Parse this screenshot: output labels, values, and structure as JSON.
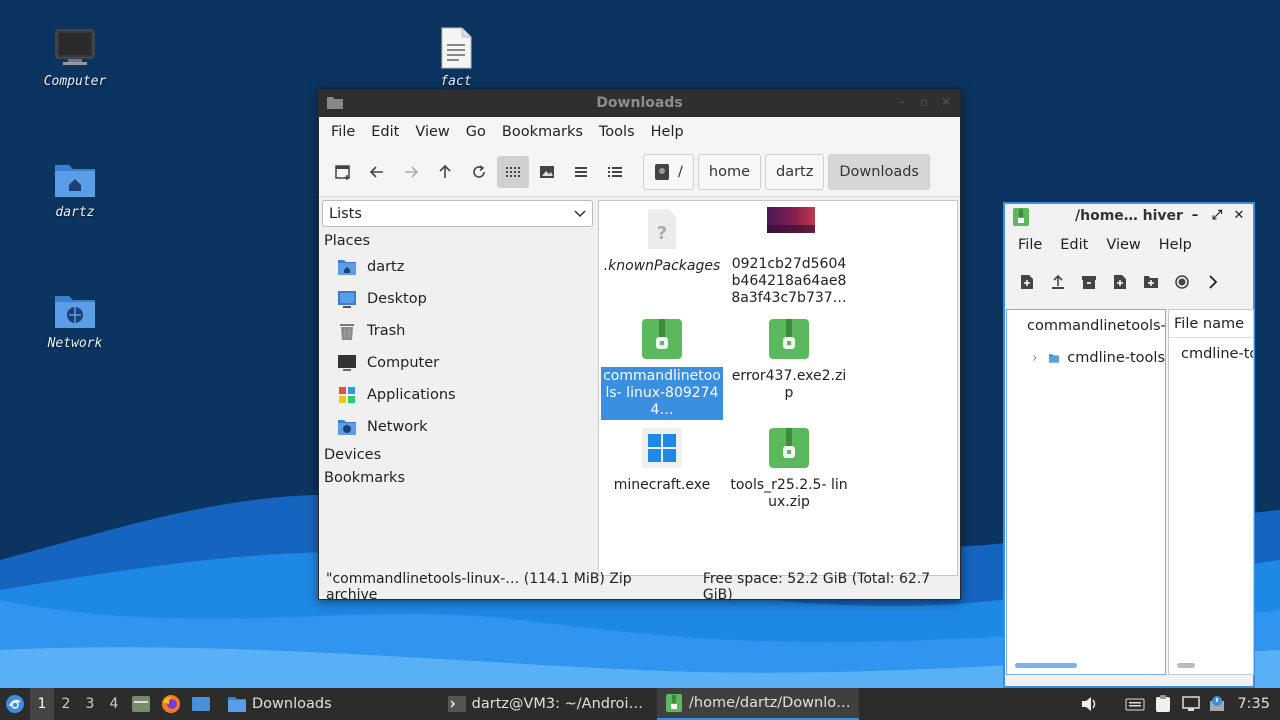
{
  "desktop": {
    "icons": [
      {
        "label": "Computer",
        "icon": "monitor-icon"
      },
      {
        "label": "fact",
        "icon": "text-file-icon"
      },
      {
        "label": "dartz",
        "icon": "home-folder-icon"
      },
      {
        "label": "Network",
        "icon": "network-folder-icon"
      }
    ]
  },
  "file_manager": {
    "title": "Downloads",
    "menu": [
      "File",
      "Edit",
      "View",
      "Go",
      "Bookmarks",
      "Tools",
      "Help"
    ],
    "path": [
      "/",
      "home",
      "dartz",
      "Downloads"
    ],
    "sidebar_mode": "Lists",
    "places_header": "Places",
    "places": [
      "dartz",
      "Desktop",
      "Trash",
      "Computer",
      "Applications",
      "Network"
    ],
    "devices_header": "Devices",
    "bookmarks_header": "Bookmarks",
    "files": [
      {
        "name": ".knownPackages",
        "type": "unknown"
      },
      {
        "name": "0921cb27d5604 b464218a64ae8 8a3f43c7b737…",
        "type": "image"
      },
      {
        "name": "commandlinetoo ls- linux-8092744…",
        "type": "zip",
        "selected": true
      },
      {
        "name": "error437.exe2.zi p",
        "type": "zip"
      },
      {
        "name": "minecraft.exe",
        "type": "exe"
      },
      {
        "name": "tools_r25.2.5- linux.zip",
        "type": "zip"
      }
    ],
    "status_selection": "\"commandlinetools-linux-… (114.1 MiB) Zip archive",
    "status_space": "Free space: 52.2 GiB (Total: 62.7 GiB)"
  },
  "archiver": {
    "title": "/home… hiver",
    "menu": [
      "File",
      "Edit",
      "View",
      "Help"
    ],
    "tree_root": "commandlinetools-linux",
    "tree_child": "cmdline-tools",
    "list_header": "File name",
    "list_item": "cmdline-tools"
  },
  "taskbar": {
    "workspaces": [
      "1",
      "2",
      "3",
      "4"
    ],
    "tasks": [
      {
        "label": "Downloads",
        "icon": "folder-icon"
      },
      {
        "label": "dartz@VM3: ~/Androi…",
        "icon": "terminal-icon"
      },
      {
        "label": "/home/dartz/Downlo…",
        "icon": "archive-icon"
      }
    ],
    "clock": "7:35"
  },
  "colors": {
    "accent": "#3a8fe0",
    "folder": "#4a90d9",
    "zip_green": "#5cb85c",
    "wallpaper": "#0c3460"
  }
}
